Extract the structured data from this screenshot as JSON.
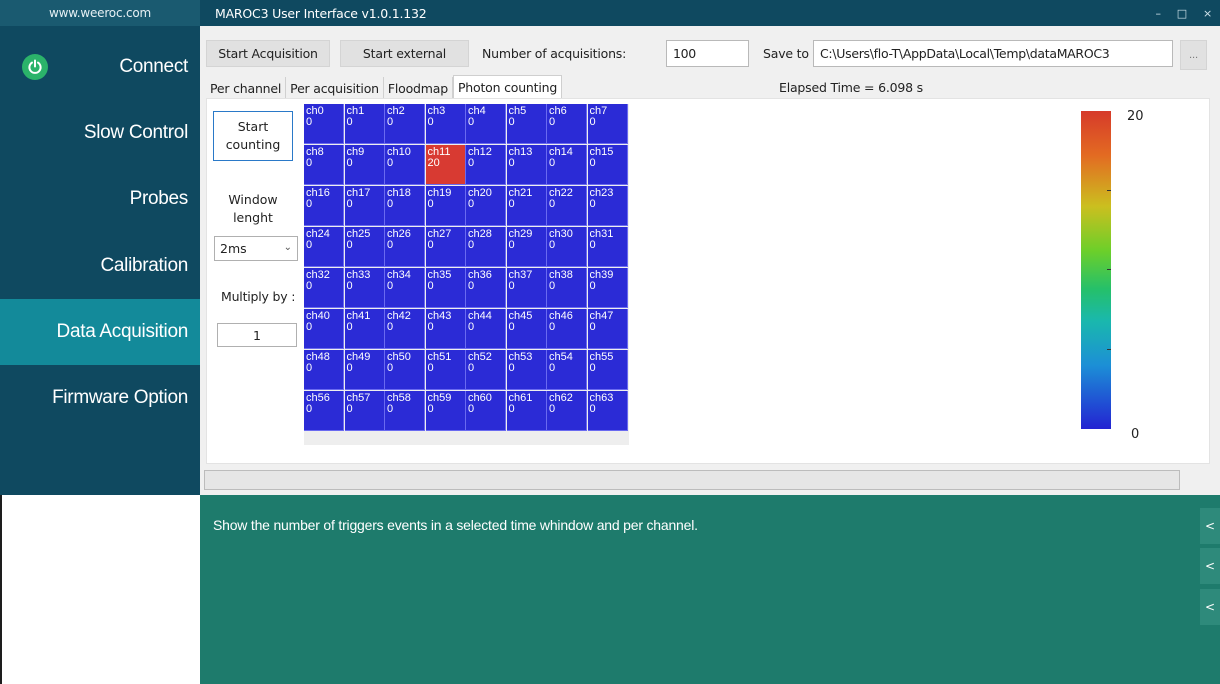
{
  "sidebar": {
    "site": "www.weeroc.com",
    "items": [
      {
        "label": "Connect"
      },
      {
        "label": "Slow Control"
      },
      {
        "label": "Probes"
      },
      {
        "label": "Calibration"
      },
      {
        "label": "Data Acquisition",
        "active": true
      },
      {
        "label": "Firmware Option"
      }
    ]
  },
  "titlebar": {
    "title": "MAROC3 User Interface v1.0.1.132",
    "minimize": "–",
    "maximize": "□",
    "close": "×"
  },
  "toolbar": {
    "start_acquisition": "Start Acquisition",
    "start_external": "Start external",
    "num_acq_label": "Number of acquisitions:",
    "num_acq_value": "100",
    "save_to_label": "Save to",
    "save_path": "C:\\Users\\flo-T\\AppData\\Local\\Temp\\dataMAROC3",
    "browse": "...",
    "elapsed": "Elapsed Time = 6.098 s"
  },
  "tabs": [
    "Per channel",
    "Per acquisition",
    "Floodmap",
    "Photon counting"
  ],
  "controls": {
    "start_counting_line1": "Start",
    "start_counting_line2": "counting",
    "window_line1": "Window",
    "window_line2": "lenght",
    "window_value": "2ms",
    "multiply_label": "Multiply by :",
    "multiply_value": "1"
  },
  "colorbar": {
    "max": "20",
    "min": "0",
    "colors": [
      "#d63a2a",
      "#cbbf1f",
      "#25c06a",
      "#1c8fd6",
      "#2323d2"
    ]
  },
  "channels": [
    {
      "name": "ch0",
      "count": "0"
    },
    {
      "name": "ch1",
      "count": "0"
    },
    {
      "name": "ch2",
      "count": "0"
    },
    {
      "name": "ch3",
      "count": "0"
    },
    {
      "name": "ch4",
      "count": "0"
    },
    {
      "name": "ch5",
      "count": "0"
    },
    {
      "name": "ch6",
      "count": "0"
    },
    {
      "name": "ch7",
      "count": "0"
    },
    {
      "name": "ch8",
      "count": "0"
    },
    {
      "name": "ch9",
      "count": "0"
    },
    {
      "name": "ch10",
      "count": "0"
    },
    {
      "name": "ch11",
      "count": "20"
    },
    {
      "name": "ch12",
      "count": "0"
    },
    {
      "name": "ch13",
      "count": "0"
    },
    {
      "name": "ch14",
      "count": "0"
    },
    {
      "name": "ch15",
      "count": "0"
    },
    {
      "name": "ch16",
      "count": "0"
    },
    {
      "name": "ch17",
      "count": "0"
    },
    {
      "name": "ch18",
      "count": "0"
    },
    {
      "name": "ch19",
      "count": "0"
    },
    {
      "name": "ch20",
      "count": "0"
    },
    {
      "name": "ch21",
      "count": "0"
    },
    {
      "name": "ch22",
      "count": "0"
    },
    {
      "name": "ch23",
      "count": "0"
    },
    {
      "name": "ch24",
      "count": "0"
    },
    {
      "name": "ch25",
      "count": "0"
    },
    {
      "name": "ch26",
      "count": "0"
    },
    {
      "name": "ch27",
      "count": "0"
    },
    {
      "name": "ch28",
      "count": "0"
    },
    {
      "name": "ch29",
      "count": "0"
    },
    {
      "name": "ch30",
      "count": "0"
    },
    {
      "name": "ch31",
      "count": "0"
    },
    {
      "name": "ch32",
      "count": "0"
    },
    {
      "name": "ch33",
      "count": "0"
    },
    {
      "name": "ch34",
      "count": "0"
    },
    {
      "name": "ch35",
      "count": "0"
    },
    {
      "name": "ch36",
      "count": "0"
    },
    {
      "name": "ch37",
      "count": "0"
    },
    {
      "name": "ch38",
      "count": "0"
    },
    {
      "name": "ch39",
      "count": "0"
    },
    {
      "name": "ch40",
      "count": "0"
    },
    {
      "name": "ch41",
      "count": "0"
    },
    {
      "name": "ch42",
      "count": "0"
    },
    {
      "name": "ch43",
      "count": "0"
    },
    {
      "name": "ch44",
      "count": "0"
    },
    {
      "name": "ch45",
      "count": "0"
    },
    {
      "name": "ch46",
      "count": "0"
    },
    {
      "name": "ch47",
      "count": "0"
    },
    {
      "name": "ch48",
      "count": "0"
    },
    {
      "name": "ch49",
      "count": "0"
    },
    {
      "name": "ch50",
      "count": "0"
    },
    {
      "name": "ch51",
      "count": "0"
    },
    {
      "name": "ch52",
      "count": "0"
    },
    {
      "name": "ch53",
      "count": "0"
    },
    {
      "name": "ch54",
      "count": "0"
    },
    {
      "name": "ch55",
      "count": "0"
    },
    {
      "name": "ch56",
      "count": "0"
    },
    {
      "name": "ch57",
      "count": "0"
    },
    {
      "name": "ch58",
      "count": "0"
    },
    {
      "name": "ch59",
      "count": "0"
    },
    {
      "name": "ch60",
      "count": "0"
    },
    {
      "name": "ch61",
      "count": "0"
    },
    {
      "name": "ch62",
      "count": "0"
    },
    {
      "name": "ch63",
      "count": "0"
    }
  ],
  "help": {
    "text": "Show the number of triggers events in a selected time whindow and per channel.",
    "arrow": "<"
  }
}
